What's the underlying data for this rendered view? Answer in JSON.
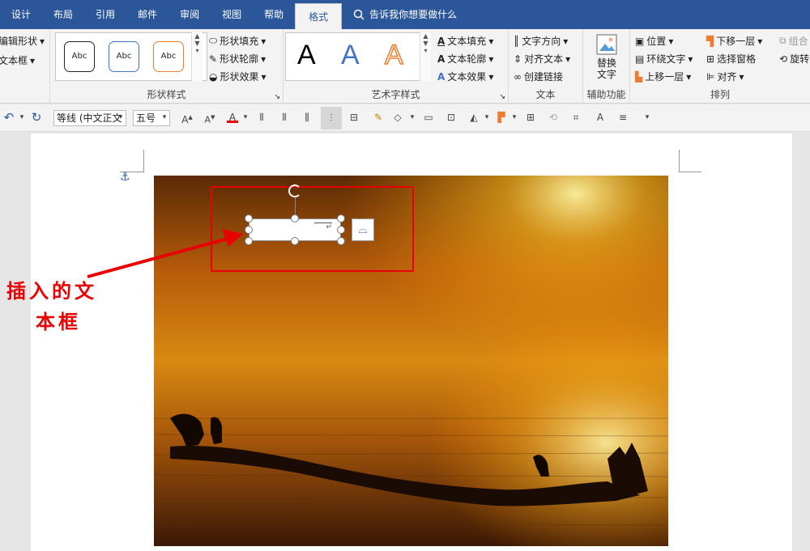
{
  "tabs": [
    "设计",
    "布局",
    "引用",
    "邮件",
    "审阅",
    "视图",
    "帮助",
    "格式"
  ],
  "active_tab": "格式",
  "tell_me": "告诉我你想要做什么",
  "insert_shapes": {
    "edit_shape": "编辑形状",
    "text_box": "文本框"
  },
  "shape_styles": {
    "sample": "Abc",
    "fill": "形状填充",
    "outline": "形状轮廓",
    "effects": "形状效果",
    "label": "形状样式"
  },
  "wordart": {
    "sample": "A",
    "text_fill": "文本填充",
    "text_outline": "文本轮廓",
    "text_effects": "文本效果",
    "label": "艺术字样式"
  },
  "text_group": {
    "direction": "文字方向",
    "align": "对齐文本",
    "link": "创建链接",
    "label": "文本"
  },
  "accessibility": {
    "alt_text_line1": "替换",
    "alt_text_line2": "文字",
    "label": "辅助功能"
  },
  "arrange": {
    "position": "位置",
    "wrap": "环绕文字",
    "bring_forward": "上移一层",
    "send_backward": "下移一层",
    "selection_pane": "选择窗格",
    "align": "对齐",
    "group": "组合",
    "rotate": "旋转",
    "label": "排列"
  },
  "qat": {
    "font_name": "等线 (中文正文",
    "font_size": "五号"
  },
  "callout": {
    "line1": "插入的文",
    "line2": "本框"
  },
  "colors": {
    "ribbon_blue": "#2b579a",
    "annotation_red": "#e80000"
  }
}
